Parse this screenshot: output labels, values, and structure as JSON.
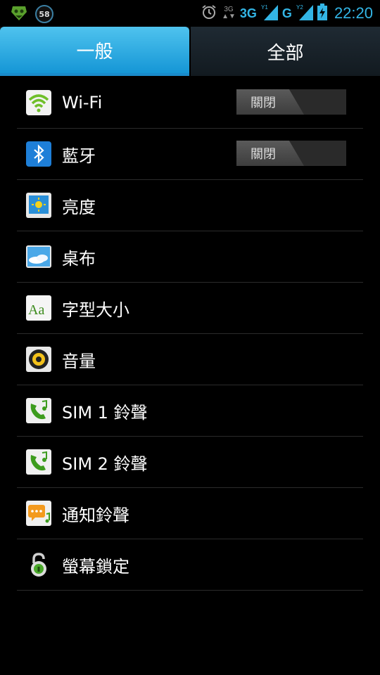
{
  "status_bar": {
    "notification_count": "58",
    "net_small": "3G",
    "net_main": "3G",
    "net_g": "G",
    "sim1": "1",
    "sim2": "2",
    "time": "22:20"
  },
  "tabs": [
    {
      "label": "一般",
      "active": true
    },
    {
      "label": "全部",
      "active": false
    }
  ],
  "settings": [
    {
      "label": "Wi-Fi",
      "icon": "wifi-icon",
      "switch": "關閉"
    },
    {
      "label": "藍牙",
      "icon": "bluetooth-icon",
      "switch": "關閉"
    },
    {
      "label": "亮度",
      "icon": "brightness-icon"
    },
    {
      "label": "桌布",
      "icon": "wallpaper-icon"
    },
    {
      "label": "字型大小",
      "icon": "font-size-icon"
    },
    {
      "label": "音量",
      "icon": "speaker-icon"
    },
    {
      "label": "SIM 1 鈴聲",
      "icon": "phone-ringtone-icon"
    },
    {
      "label": "SIM 2 鈴聲",
      "icon": "phone-ringtone-icon"
    },
    {
      "label": "通知鈴聲",
      "icon": "notification-sound-icon"
    },
    {
      "label": "螢幕鎖定",
      "icon": "lock-icon"
    }
  ],
  "font_icon_text": "Aa",
  "colors": {
    "accent": "#33b5e5",
    "tab_active": "#1596d6"
  }
}
